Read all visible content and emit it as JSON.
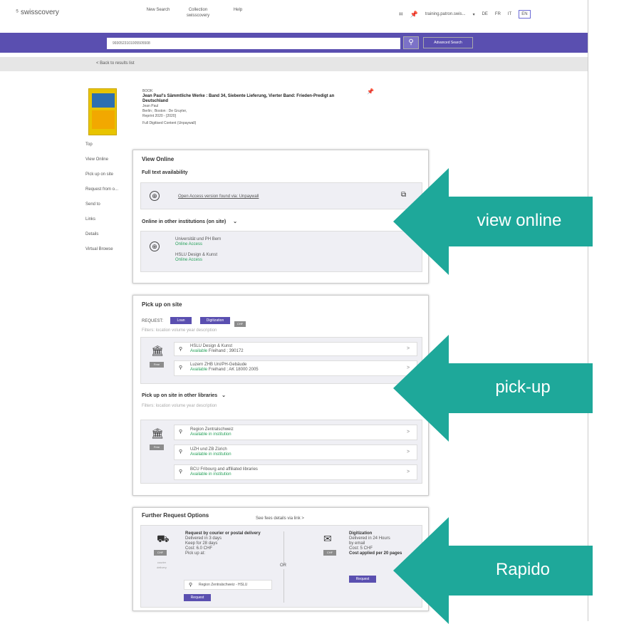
{
  "header": {
    "logo": "swisscovery",
    "nav": [
      "New Search",
      "Collection swisscovery",
      "Help"
    ],
    "user": "training.patron.swis...",
    "languages": [
      "DE",
      "FR",
      "IT",
      "EN"
    ]
  },
  "search": {
    "value": "9930523101005505508",
    "advanced_label": "Advanced Search"
  },
  "back_label": "< Back to results list",
  "record": {
    "type": "BOOK",
    "title": "Jean Paul's Sämmtliche Werke : Band 34, Siebente Lieferung, Vierter Band: Frieden-Predigt an Deutschland",
    "author": "Jean Paul",
    "publisher": "Berlin ; Boston : De Gruyter,",
    "year": "Reprint 2020 - [2020]",
    "note": "Full Digitised Content (Unpaywall)"
  },
  "sidenav": [
    "Top",
    "View Online",
    "Pick up on site",
    "Request from o...",
    "Send to",
    "Links",
    "Details",
    "Virtual Browse"
  ],
  "view_online": {
    "title": "View Online",
    "full_text": "Full text availability",
    "oa_link": "Open Access version found via: Unpaywall",
    "other_title": "Online in other institutions (on site)",
    "institutions": [
      {
        "name": "Universität und PH Bern",
        "status": "Online Access"
      },
      {
        "name": "HSLU Design & Kunst",
        "status": "Online Access"
      }
    ]
  },
  "pickup": {
    "title": "Pick up on site",
    "request_label": "REQUEST:",
    "loan_label": "Loan",
    "digitization_label": "Digitization",
    "chf": "CHF",
    "filters": "Filters: location volume year description",
    "free": "Free",
    "locations": [
      {
        "name": "HSLU Design & Kunst",
        "status": "Available",
        "detail": "Freihand ; 390172"
      },
      {
        "name": "Luzern ZHB Uni/PH-Gebäude",
        "status": "Available",
        "detail": "Freihand ; AK 18000 2005"
      }
    ],
    "other_title": "Pick up on site in other libraries",
    "other_filters": "Filters: location volume year description",
    "other_locations": [
      {
        "name": "Region Zentralschweiz",
        "status": "Available in institution"
      },
      {
        "name": "UZH und ZB Zürich",
        "status": "Available in institution"
      },
      {
        "name": "BCU Fribourg and affiliated libraries",
        "status": "Available in institution"
      }
    ]
  },
  "further": {
    "title": "Further Request Options",
    "fees_link": "See fees details via link >",
    "courier": {
      "heading": "Request by courier or postal delivery",
      "lines": [
        "Delivered in 3 days",
        "Keep for 28 days",
        "Cost: 6.0 CHF",
        "Pick up at:"
      ],
      "location": "Region Zentralschweiz - HSLU",
      "button": "Request",
      "price_tag": "CHF",
      "note": "courier delivery"
    },
    "or": "OR",
    "digitization": {
      "heading": "Digitization",
      "lines": [
        "Delivered in 24 Hours",
        "by email",
        "Cost: 5 CHF",
        "Cost applied per 20 pages"
      ],
      "button": "Request",
      "price_tag": "CHF"
    }
  },
  "callouts": [
    "view online",
    "pick-up",
    "Rapido"
  ],
  "colors": {
    "accent": "#5a4fb0",
    "callout": "#1ea89a"
  }
}
